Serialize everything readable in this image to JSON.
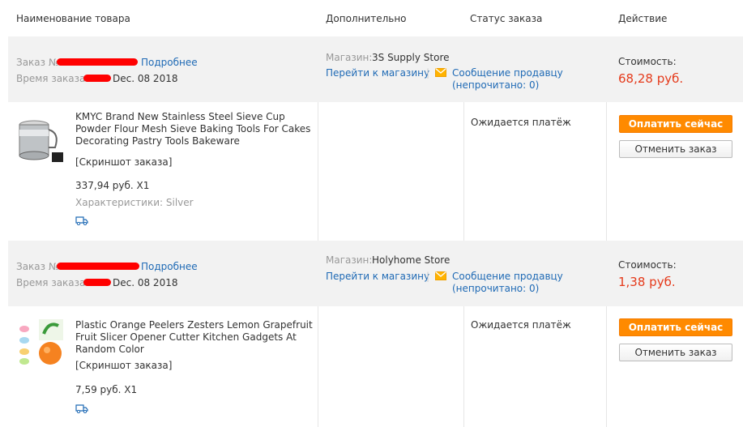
{
  "header": {
    "col_product": "Наименование товара",
    "col_additional": "Дополнительно",
    "col_status": "Статус заказа",
    "col_action": "Действие"
  },
  "colors": {
    "accent": "#ff8a00",
    "link": "#1f6ab5",
    "price": "#e53a1b",
    "band": "#f2f2f2"
  },
  "orders": [
    {
      "order_label": "Заказ №:",
      "details_link": "Подробнее",
      "time_label": "Время заказа:",
      "date": "Dec. 08 2018",
      "store_label": "Магазин:",
      "store_name": "3S Supply Store",
      "go_store": "Перейти к магазину",
      "separator": "|",
      "message_link": "Сообщение продавцу",
      "unread": "(непрочитано: 0)",
      "cost_label": "Стоимость:",
      "cost": "68,28 руб.",
      "product_name": "KMYC Brand New Stainless Steel Sieve Cup Powder Flour Mesh Sieve Baking Tools For Cakes Decorating Pastry Tools Bakeware",
      "snapshot": "[Скриншот заказа]",
      "price_qty": "337,94 руб. X1",
      "characteristics": "Характеристики: Silver",
      "status": "Ожидается платёж",
      "pay_button": "Оплатить сейчас",
      "cancel_button": "Отменить заказ",
      "icon": "truck-icon"
    },
    {
      "order_label": "Заказ №:",
      "details_link": "Подробнее",
      "time_label": "Время заказа:",
      "date": "Dec. 08 2018",
      "store_label": "Магазин:",
      "store_name": "Holyhome Store",
      "go_store": "Перейти к магазину",
      "separator": "|",
      "message_link": "Сообщение продавцу",
      "unread": "(непрочитано: 0)",
      "cost_label": "Стоимость:",
      "cost": "1,38 руб.",
      "product_name": "Plastic Orange Peelers Zesters Lemon Grapefruit Fruit Slicer Opener Cutter Kitchen Gadgets At Random Color",
      "snapshot": "[Скриншот заказа]",
      "price_qty": "7,59 руб. X1",
      "status": "Ожидается платёж",
      "pay_button": "Оплатить сейчас",
      "cancel_button": "Отменить заказ",
      "icon": "truck-icon"
    }
  ]
}
